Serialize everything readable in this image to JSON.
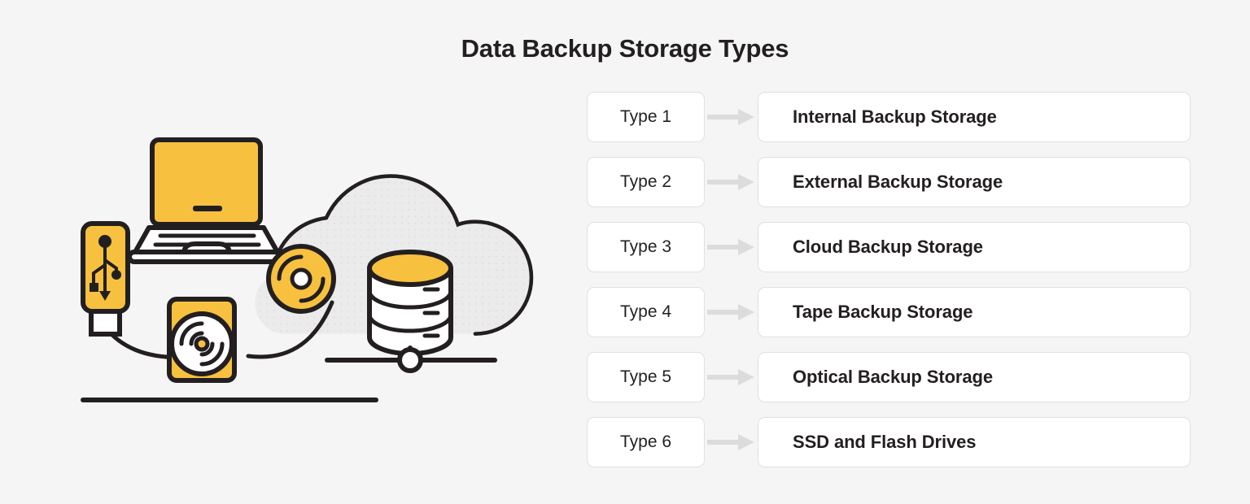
{
  "page": {
    "title": "Data Backup Storage Types",
    "background_color": "#f5f5f5",
    "accent_color": "#f7c13f",
    "ink_color": "#231f20",
    "border_color": "#e0e0e0",
    "arrow_color": "#dcdcdc",
    "cloud_color": "#ebebeb"
  },
  "list": {
    "rows": [
      {
        "type": "Type 1",
        "arrow": "arrow-right-icon",
        "label": "Internal Backup Storage"
      },
      {
        "type": "Type 2",
        "arrow": "arrow-right-icon",
        "label": "External Backup Storage"
      },
      {
        "type": "Type 3",
        "arrow": "arrow-right-icon",
        "label": "Cloud Backup Storage"
      },
      {
        "type": "Type 4",
        "arrow": "arrow-right-icon",
        "label": "Tape Backup Storage"
      },
      {
        "type": "Type 5",
        "arrow": "arrow-right-icon",
        "label": "Optical Backup Storage"
      },
      {
        "type": "Type 6",
        "arrow": "arrow-right-icon",
        "label": "SSD and Flash Drives"
      }
    ]
  },
  "illustration": {
    "icons": [
      "usb-flash-drive-icon",
      "laptop-icon",
      "sd-card-disc-icon",
      "optical-disc-icon",
      "cloud-icon",
      "database-server-icon",
      "network-node-icon",
      "ground-line"
    ]
  }
}
